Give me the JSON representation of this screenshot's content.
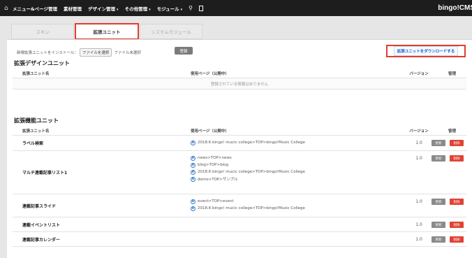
{
  "topbar": {
    "nav": [
      {
        "label": "メニュー&ページ管理"
      },
      {
        "label": "素材管理"
      },
      {
        "label": "デザイン管理",
        "caret": "▾"
      },
      {
        "label": "その他管理",
        "caret": "▾"
      },
      {
        "label": "モジュール",
        "caret": "▾"
      }
    ],
    "brand": "bingo!CMS"
  },
  "tabs": [
    {
      "label": "スキン"
    },
    {
      "label": "拡張ユニット"
    },
    {
      "label": "システムモジュール"
    }
  ],
  "install": {
    "label": "新規拡張ユニットをインストール：",
    "file_button": "ファイルを選択",
    "file_status": "ファイル未選択",
    "register_button": "登録"
  },
  "download_button": "拡張ユニットをダウンロードする",
  "design_section": {
    "title": "拡張デザインユニット",
    "headers": {
      "name": "拡張ユニット名",
      "page": "使用ページ（公開中）",
      "version": "バージョン",
      "manage": "管理"
    },
    "empty_message": "登録されている情報はありません"
  },
  "function_section": {
    "title": "拡張機能ユニット",
    "headers": {
      "name": "拡張ユニット名",
      "page": "使用ページ（公開中）",
      "version": "バージョン",
      "manage": "管理"
    },
    "rows": [
      {
        "name": "ラベル検索",
        "pages": [
          "2018.6 bingo! mucic college>TOP>bingo!Music College"
        ],
        "version": "1.0"
      },
      {
        "name": "マルチ連載記事リスト1",
        "pages": [
          "news>TOP>news",
          "blog>TOP>blog",
          "2018.6 bingo! mucic college>TOP>bingo!Music College",
          "demo>TOP>サンプル"
        ],
        "version": "1.0"
      },
      {
        "name": "連載記事スライド",
        "pages": [
          "event>TOP>event",
          "2018.6 bingo! mucic college>TOP>bingo!Music College"
        ],
        "version": "1.0"
      },
      {
        "name": "連載イベントリスト",
        "pages": [],
        "version": "1.0"
      },
      {
        "name": "連載記事カレンダー",
        "pages": [],
        "version": "1.0"
      }
    ],
    "update_label": "更新",
    "delete_label": "削除"
  },
  "icons": {
    "home": "home-icon",
    "search": "search-icon",
    "doc": "document-icon",
    "page": "ie-browser-icon"
  },
  "colors": {
    "accent_red": "#e23d2d",
    "topbar": "#1d1d1d",
    "link_blue": "#1a5fc8"
  }
}
